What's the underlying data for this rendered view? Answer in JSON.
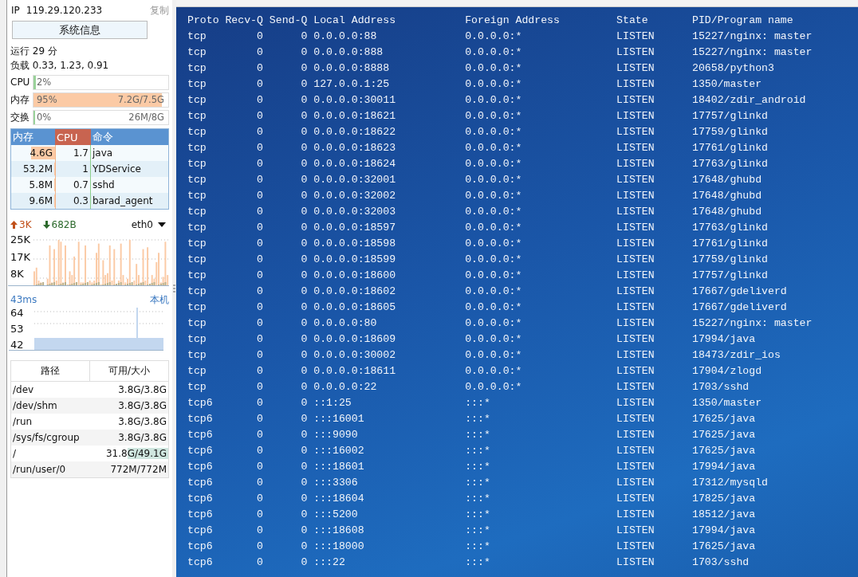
{
  "sidebar": {
    "ip_label": "IP",
    "ip": "119.29.120.233",
    "copy_link": "复制",
    "system_info_button": "系统信息",
    "uptime": "运行 29 分",
    "load": "负载 0.33, 1.23, 0.91",
    "meters": [
      {
        "label": "CPU",
        "percent": "2%",
        "level": 0.02,
        "color": "#9ad29a"
      },
      {
        "label": "内存",
        "percent": "95%",
        "usage": "7.2G/7.5G",
        "level": 0.95,
        "color": "#fbcaa5"
      },
      {
        "label": "交换",
        "percent": "0%",
        "usage": "26M/8G",
        "level": 0,
        "color": "#9ad29a"
      }
    ],
    "process_table": {
      "columns": [
        "内存",
        "CPU",
        "命令"
      ],
      "rows": [
        {
          "memory": "4.6G",
          "cpu": "1.7",
          "command": "java",
          "level": 0.55
        },
        {
          "memory": "53.2M",
          "cpu": "1",
          "command": "YDService",
          "level": 0.02
        },
        {
          "memory": "5.8M",
          "cpu": "0.7",
          "command": "sshd",
          "level": 0.02
        },
        {
          "memory": "9.6M",
          "cpu": "0.3",
          "command": "barad_agent",
          "level": 0.02
        }
      ]
    },
    "network": {
      "upload": "3K",
      "download": "682B",
      "interface": "eth0",
      "axis_labels": [
        "25K",
        "17K",
        "8K"
      ]
    },
    "latency": {
      "value": "43ms",
      "target": "本机",
      "axis_labels": [
        "64",
        "53",
        "42"
      ]
    },
    "disk_table": {
      "columns": [
        "路径",
        "可用/大小"
      ],
      "rows": [
        {
          "path": "/dev",
          "usage": "3.8G/3.8G",
          "highlighted": false
        },
        {
          "path": "/dev/shm",
          "usage": "3.8G/3.8G",
          "highlighted": false
        },
        {
          "path": "/run",
          "usage": "3.8G/3.8G",
          "highlighted": false
        },
        {
          "path": "/sys/fs/cgroup",
          "usage": "3.8G/3.8G",
          "highlighted": false
        },
        {
          "path": "/",
          "usage": "31.8G/49.1G",
          "highlighted": true
        },
        {
          "path": "/run/user/0",
          "usage": "772M/772M",
          "highlighted": false
        }
      ]
    }
  },
  "terminal": {
    "columns": [
      "Proto",
      "Recv-Q",
      "Send-Q",
      "Local Address",
      "Foreign Address",
      "State",
      "PID/Program name"
    ],
    "rows": [
      [
        "tcp",
        "0",
        "0",
        "0.0.0.0:88",
        "0.0.0.0:*",
        "LISTEN",
        "15227/nginx: master"
      ],
      [
        "tcp",
        "0",
        "0",
        "0.0.0.0:888",
        "0.0.0.0:*",
        "LISTEN",
        "15227/nginx: master"
      ],
      [
        "tcp",
        "0",
        "0",
        "0.0.0.0:8888",
        "0.0.0.0:*",
        "LISTEN",
        "20658/python3"
      ],
      [
        "tcp",
        "0",
        "0",
        "127.0.0.1:25",
        "0.0.0.0:*",
        "LISTEN",
        "1350/master"
      ],
      [
        "tcp",
        "0",
        "0",
        "0.0.0.0:30011",
        "0.0.0.0:*",
        "LISTEN",
        "18402/zdir_android"
      ],
      [
        "tcp",
        "0",
        "0",
        "0.0.0.0:18621",
        "0.0.0.0:*",
        "LISTEN",
        "17757/glinkd"
      ],
      [
        "tcp",
        "0",
        "0",
        "0.0.0.0:18622",
        "0.0.0.0:*",
        "LISTEN",
        "17759/glinkd"
      ],
      [
        "tcp",
        "0",
        "0",
        "0.0.0.0:18623",
        "0.0.0.0:*",
        "LISTEN",
        "17761/glinkd"
      ],
      [
        "tcp",
        "0",
        "0",
        "0.0.0.0:18624",
        "0.0.0.0:*",
        "LISTEN",
        "17763/glinkd"
      ],
      [
        "tcp",
        "0",
        "0",
        "0.0.0.0:32001",
        "0.0.0.0:*",
        "LISTEN",
        "17648/ghubd"
      ],
      [
        "tcp",
        "0",
        "0",
        "0.0.0.0:32002",
        "0.0.0.0:*",
        "LISTEN",
        "17648/ghubd"
      ],
      [
        "tcp",
        "0",
        "0",
        "0.0.0.0:32003",
        "0.0.0.0:*",
        "LISTEN",
        "17648/ghubd"
      ],
      [
        "tcp",
        "0",
        "0",
        "0.0.0.0:18597",
        "0.0.0.0:*",
        "LISTEN",
        "17763/glinkd"
      ],
      [
        "tcp",
        "0",
        "0",
        "0.0.0.0:18598",
        "0.0.0.0:*",
        "LISTEN",
        "17761/glinkd"
      ],
      [
        "tcp",
        "0",
        "0",
        "0.0.0.0:18599",
        "0.0.0.0:*",
        "LISTEN",
        "17759/glinkd"
      ],
      [
        "tcp",
        "0",
        "0",
        "0.0.0.0:18600",
        "0.0.0.0:*",
        "LISTEN",
        "17757/glinkd"
      ],
      [
        "tcp",
        "0",
        "0",
        "0.0.0.0:18602",
        "0.0.0.0:*",
        "LISTEN",
        "17667/gdeliverd"
      ],
      [
        "tcp",
        "0",
        "0",
        "0.0.0.0:18605",
        "0.0.0.0:*",
        "LISTEN",
        "17667/gdeliverd"
      ],
      [
        "tcp",
        "0",
        "0",
        "0.0.0.0:80",
        "0.0.0.0:*",
        "LISTEN",
        "15227/nginx: master"
      ],
      [
        "tcp",
        "0",
        "0",
        "0.0.0.0:18609",
        "0.0.0.0:*",
        "LISTEN",
        "17994/java"
      ],
      [
        "tcp",
        "0",
        "0",
        "0.0.0.0:30002",
        "0.0.0.0:*",
        "LISTEN",
        "18473/zdir_ios"
      ],
      [
        "tcp",
        "0",
        "0",
        "0.0.0.0:18611",
        "0.0.0.0:*",
        "LISTEN",
        "17904/zlogd"
      ],
      [
        "tcp",
        "0",
        "0",
        "0.0.0.0:22",
        "0.0.0.0:*",
        "LISTEN",
        "1703/sshd"
      ],
      [
        "tcp6",
        "0",
        "0",
        "::1:25",
        ":::*",
        "LISTEN",
        "1350/master"
      ],
      [
        "tcp6",
        "0",
        "0",
        ":::16001",
        ":::*",
        "LISTEN",
        "17625/java"
      ],
      [
        "tcp6",
        "0",
        "0",
        ":::9090",
        ":::*",
        "LISTEN",
        "17625/java"
      ],
      [
        "tcp6",
        "0",
        "0",
        ":::16002",
        ":::*",
        "LISTEN",
        "17625/java"
      ],
      [
        "tcp6",
        "0",
        "0",
        ":::18601",
        ":::*",
        "LISTEN",
        "17994/java"
      ],
      [
        "tcp6",
        "0",
        "0",
        ":::3306",
        ":::*",
        "LISTEN",
        "17312/mysqld"
      ],
      [
        "tcp6",
        "0",
        "0",
        ":::18604",
        ":::*",
        "LISTEN",
        "17825/java"
      ],
      [
        "tcp6",
        "0",
        "0",
        ":::5200",
        ":::*",
        "LISTEN",
        "18512/java"
      ],
      [
        "tcp6",
        "0",
        "0",
        ":::18608",
        ":::*",
        "LISTEN",
        "17994/java"
      ],
      [
        "tcp6",
        "0",
        "0",
        ":::18000",
        ":::*",
        "LISTEN",
        "17625/java"
      ],
      [
        "tcp6",
        "0",
        "0",
        ":::22",
        ":::*",
        "LISTEN",
        "1703/sshd"
      ]
    ]
  }
}
